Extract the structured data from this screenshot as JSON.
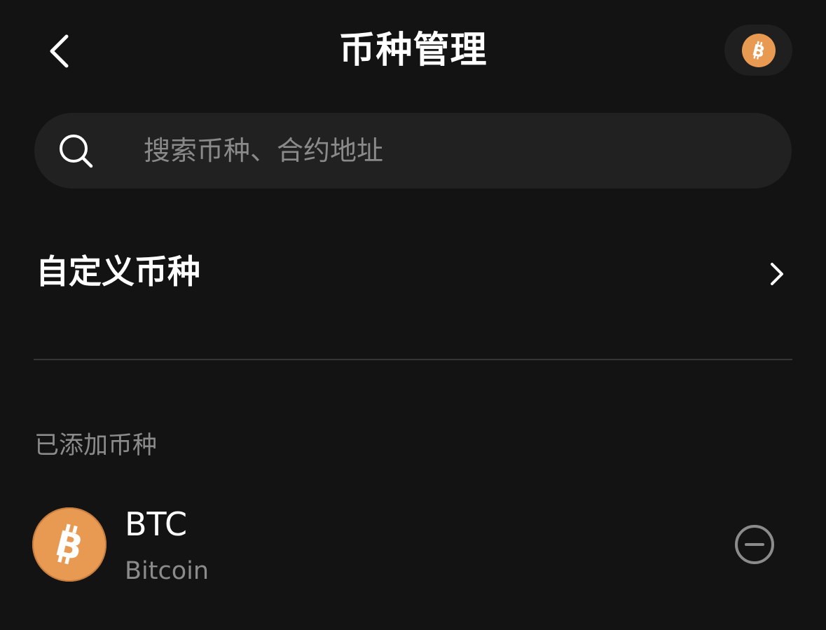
{
  "header": {
    "title": "币种管理",
    "back_icon": "chevron-left-icon",
    "coin_icon": "bitcoin-icon"
  },
  "search": {
    "placeholder": "搜索币种、合约地址",
    "value": "",
    "icon": "search-icon"
  },
  "custom_coin": {
    "label": "自定义币种",
    "icon": "chevron-right-icon"
  },
  "added_section": {
    "label": "已添加币种",
    "coins": [
      {
        "symbol": "BTC",
        "name": "Bitcoin",
        "logo_icon": "bitcoin-icon",
        "action_icon": "minus-circle-icon"
      }
    ]
  },
  "colors": {
    "background": "#131313",
    "surface": "#212121",
    "bitcoin_orange": "#e99a52",
    "secondary_text": "#8b8b8b"
  }
}
